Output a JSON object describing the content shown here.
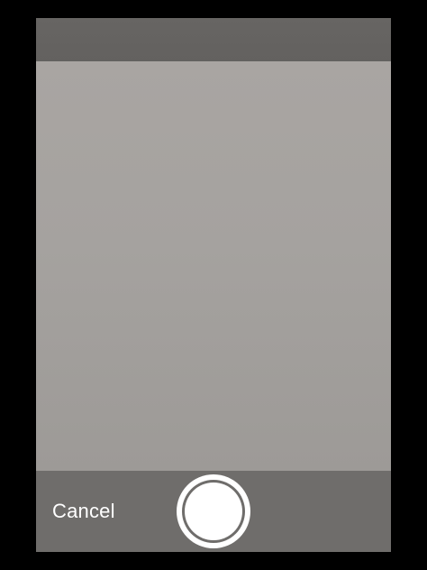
{
  "camera": {
    "cancel_label": "Cancel",
    "shutter_icon": "circle-shutter-icon"
  },
  "colors": {
    "background": "#000000",
    "bars": "#6f6d6b",
    "viewfinder": "#a5a29f",
    "shutter": "#ffffff",
    "text": "#ffffff"
  }
}
